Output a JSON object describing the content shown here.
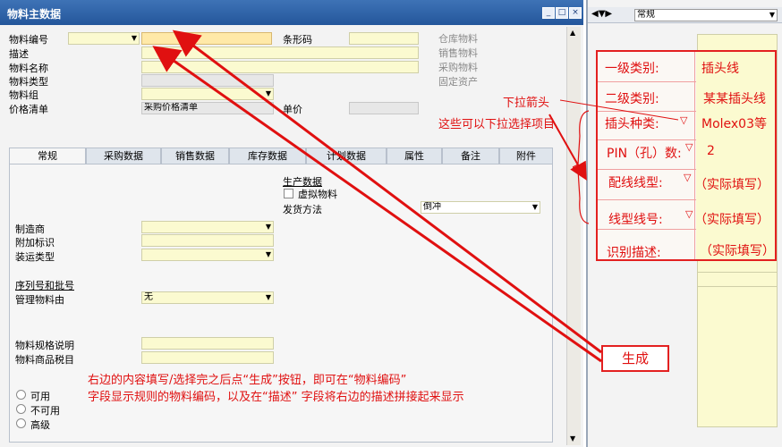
{
  "window": {
    "title": "物料主数据",
    "buttons": [
      "_",
      "□",
      "×"
    ]
  },
  "header": {
    "item_code_label": "物料编号",
    "barcode_label": "条形码",
    "description_label": "描述",
    "item_name_label": "物料名称",
    "item_type_label": "物料类型",
    "item_group_label": "物料组",
    "price_list_label": "价格清单",
    "price_list_value": "采购价格清单",
    "unit_price_label": "单价",
    "flags": [
      "仓库物料",
      "销售物料",
      "采购物料",
      "固定资产"
    ]
  },
  "tabs": [
    "常规",
    "采购数据",
    "销售数据",
    "库存数据",
    "计划数据",
    "属性",
    "备注",
    "附件"
  ],
  "general": {
    "production_header": "生产数据",
    "virtual_item": "虚拟物料",
    "issue_method_label": "发货方法",
    "issue_method_value": "倒冲",
    "manufacturer_label": "制造商",
    "additional_id_label": "附加标识",
    "shipping_type_label": "装运类型",
    "serial_header": "序列号和批号",
    "manage_by_label": "管理物料由",
    "manage_by_value": "无",
    "spec_label": "物料规格说明",
    "tax_label": "物料商品税目",
    "status": [
      "可用",
      "不可用",
      "高级"
    ]
  },
  "right_panel": {
    "nav_value": "常规",
    "rows": [
      {
        "label": "一级类别:",
        "value": "插头线"
      },
      {
        "label": "二级类别:",
        "value": "某某插头线"
      },
      {
        "label": "插头种类:",
        "value": "Molex03等"
      },
      {
        "label": "PIN（孔）数:",
        "value": "2"
      },
      {
        "label": "配线线型:",
        "value": "（实际填写）"
      },
      {
        "label": "线型线号:",
        "value": "（实际填写）"
      },
      {
        "label": "识别描述:",
        "value": "（实际填写）"
      }
    ]
  },
  "annotations": {
    "dropdown_arrow": "下拉箭头",
    "dropdown_note": "这些可以下拉选择项目",
    "generate": "生成",
    "bottom_line1": "右边的内容填写/选择完之后点“生成”按钮，即可在“物料编码”",
    "bottom_line2": "字段显示规则的物料编码，以及在“描述” 字段将右边的描述拼接起来显示"
  },
  "colors": {
    "title_bar": "#2f62a8",
    "field": "#fbfad0",
    "annotation": "#e01010"
  }
}
